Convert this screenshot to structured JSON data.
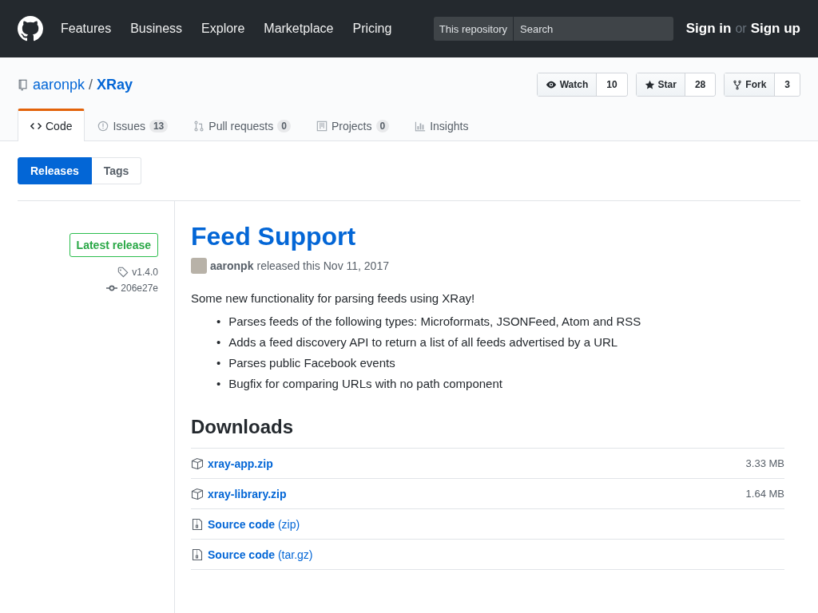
{
  "header": {
    "nav": [
      "Features",
      "Business",
      "Explore",
      "Marketplace",
      "Pricing"
    ],
    "search_scope": "This repository",
    "search": {
      "placeholder": "Search"
    },
    "sign_in": "Sign in",
    "or": "or",
    "sign_up": "Sign up"
  },
  "repo": {
    "owner": "aaronpk",
    "separator": "/",
    "name": "XRay",
    "actions": [
      {
        "kind": "eye",
        "label": "Watch",
        "count": "10"
      },
      {
        "kind": "star",
        "label": "Star",
        "count": "28"
      },
      {
        "kind": "fork",
        "label": "Fork",
        "count": "3"
      }
    ]
  },
  "tabs": [
    {
      "kind": "code",
      "label": "Code",
      "selected": true
    },
    {
      "kind": "issue",
      "label": "Issues",
      "count": "13",
      "selected": false
    },
    {
      "kind": "pr",
      "label": "Pull requests",
      "count": "0",
      "selected": false
    },
    {
      "kind": "project",
      "label": "Projects",
      "count": "0",
      "selected": false
    },
    {
      "kind": "graph",
      "label": "Insights",
      "selected": false
    }
  ],
  "subnav": [
    {
      "label": "Releases",
      "selected": true
    },
    {
      "label": "Tags",
      "selected": false
    }
  ],
  "release": {
    "badge": "Latest release",
    "tag": "v1.4.0",
    "commit": "206e27e",
    "title": "Feed Support",
    "author": "aaronpk",
    "meta": "released this Nov 11, 2017",
    "intro": "Some new functionality for parsing feeds using XRay!",
    "bullets": [
      {
        "marker": "•",
        "text": "Parses feeds of the following types: Microformats, JSONFeed, Atom and RSS"
      },
      {
        "marker": "•",
        "text": "Adds a feed discovery API to return a list of all feeds advertised by a URL"
      },
      {
        "marker": "•",
        "text": "Parses public Facebook events"
      },
      {
        "marker": "•",
        "text": "Bugfix for comparing URLs with no path component"
      }
    ],
    "downloads_title": "Downloads",
    "downloads": [
      {
        "kind": "asset",
        "name": "xray-app.zip",
        "size": "3.33 MB"
      },
      {
        "kind": "asset",
        "name": "xray-library.zip",
        "size": "1.64 MB"
      },
      {
        "kind": "source",
        "name": "**Source code** (zip)"
      },
      {
        "kind": "source",
        "name": "**Source code** (tar.gz)"
      }
    ]
  }
}
